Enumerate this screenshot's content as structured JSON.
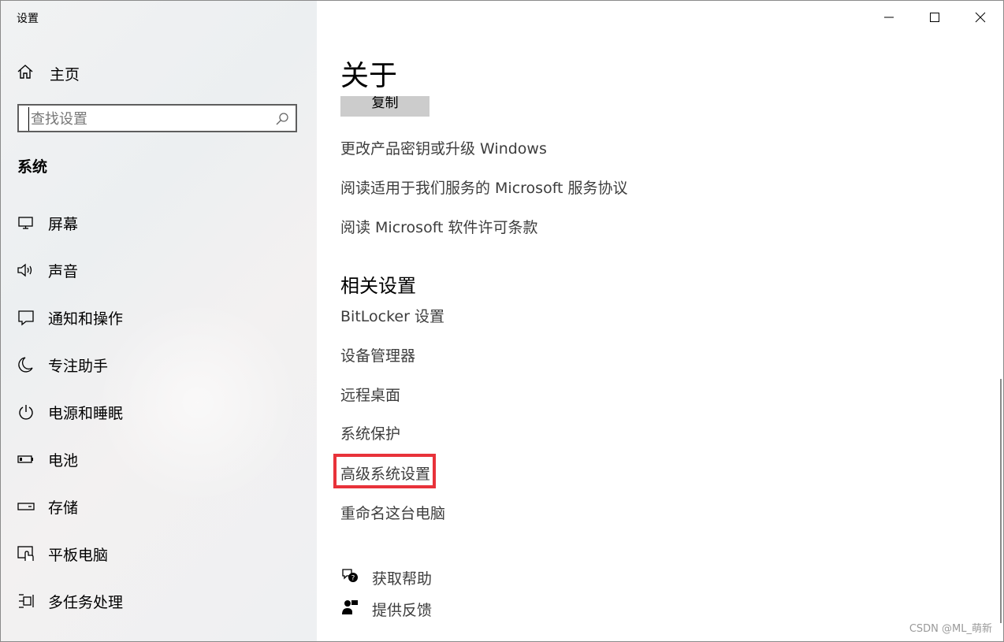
{
  "app_title": "设置",
  "sidebar": {
    "home_label": "主页",
    "search_placeholder": "查找设置",
    "section_title": "系统",
    "items": [
      {
        "label": "屏幕",
        "icon": "monitor-icon"
      },
      {
        "label": "声音",
        "icon": "speaker-icon"
      },
      {
        "label": "通知和操作",
        "icon": "notification-icon"
      },
      {
        "label": "专注助手",
        "icon": "moon-icon"
      },
      {
        "label": "电源和睡眠",
        "icon": "power-icon"
      },
      {
        "label": "电池",
        "icon": "battery-icon"
      },
      {
        "label": "存储",
        "icon": "storage-icon"
      },
      {
        "label": "平板电脑",
        "icon": "tablet-icon"
      },
      {
        "label": "多任务处理",
        "icon": "multitask-icon"
      }
    ]
  },
  "main": {
    "title": "关于",
    "copy_button": "复制",
    "links": [
      "更改产品密钥或升级 Windows",
      "阅读适用于我们服务的 Microsoft 服务协议",
      "阅读 Microsoft 软件许可条款"
    ],
    "related_title": "相关设置",
    "related_links": [
      "BitLocker 设置",
      "设备管理器",
      "远程桌面",
      "系统保护",
      "高级系统设置",
      "重命名这台电脑"
    ],
    "help": {
      "get_help": "获取帮助",
      "feedback": "提供反馈"
    }
  },
  "watermark": "CSDN @ML_萌新",
  "colors": {
    "highlight": "#e8323a",
    "link": "#3d3d3d",
    "copy_button_bg": "#cccccc"
  }
}
